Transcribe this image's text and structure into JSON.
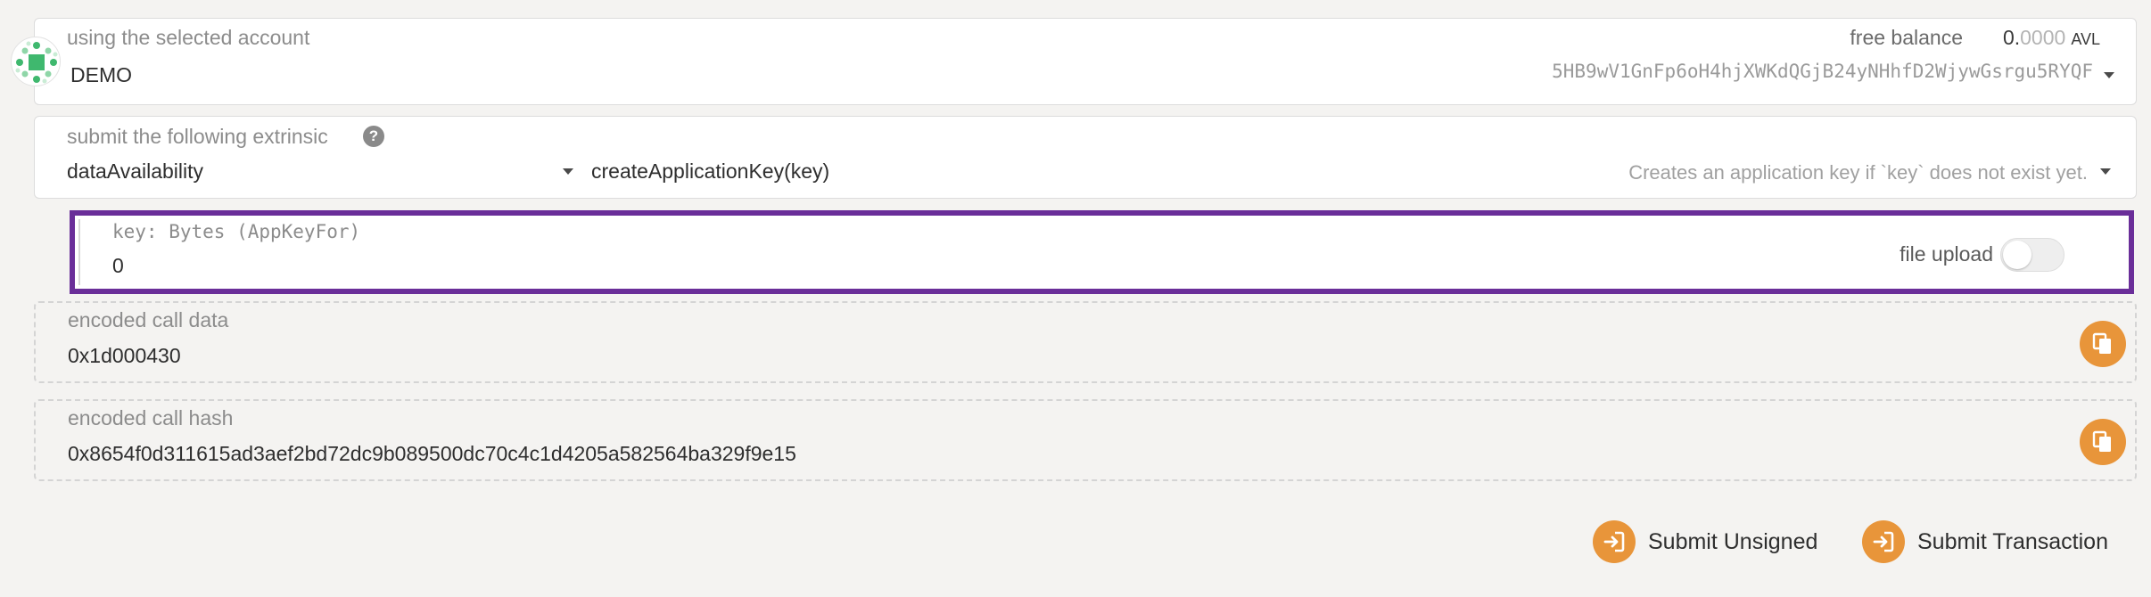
{
  "account": {
    "label": "using the selected account",
    "name": "DEMO",
    "balance_label": "free balance",
    "balance_int": "0.",
    "balance_dec": "0000",
    "balance_unit": "AVL",
    "address": "5HB9wV1GnFp6oH4hjXWKdQGjB24yNHhfD2WjywGsrgu5RYQF"
  },
  "extrinsic": {
    "label": "submit the following extrinsic",
    "module": "dataAvailability",
    "method": "createApplicationKey(key)",
    "description": "Creates an application key if `key` does not exist yet."
  },
  "param": {
    "label": "key: Bytes (AppKeyFor)",
    "value": "0",
    "file_upload_label": "file upload",
    "file_upload_enabled": false
  },
  "encoded_call_data": {
    "label": "encoded call data",
    "value": "0x1d000430"
  },
  "encoded_call_hash": {
    "label": "encoded call hash",
    "value": "0x8654f0d311615ad3aef2bd72dc9b089500dc70c4c1d4205a582564ba329f9e15"
  },
  "actions": {
    "submit_unsigned": "Submit Unsigned",
    "submit_transaction": "Submit Transaction"
  },
  "colors": {
    "accent": "#e8953a",
    "highlight": "#6a2e99",
    "identicon": "#3fb86e"
  }
}
